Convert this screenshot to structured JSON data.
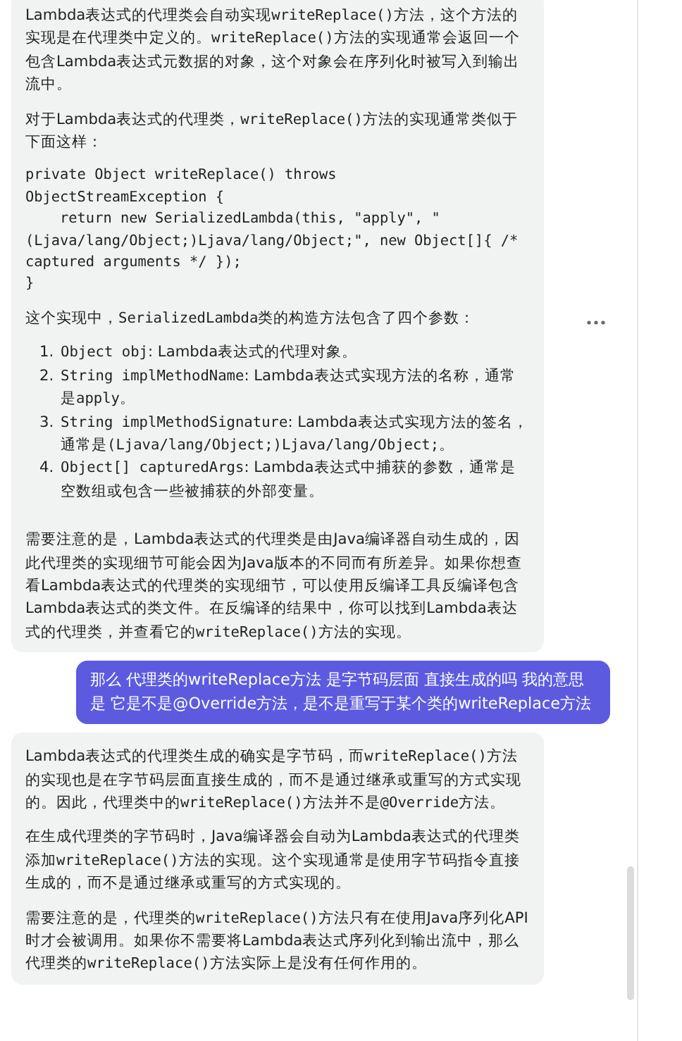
{
  "messages": [
    {
      "kind": "assistant_message",
      "blocks": [
        {
          "kind": "paragraph",
          "segments": [
            {
              "text": "Lambda表达式的代理类会自动实现",
              "code": false
            },
            {
              "text": "writeReplace()",
              "code": true
            },
            {
              "text": "方法，这个方法的实现是在代理类中定义的。",
              "code": false
            },
            {
              "text": "writeReplace()",
              "code": true
            },
            {
              "text": "方法的实现通常会返回一个包含Lambda表达式元数据的对象，这个对象会在序列化时被写入到输出流中。",
              "code": false
            }
          ]
        },
        {
          "kind": "paragraph",
          "segments": [
            {
              "text": "对于Lambda表达式的代理类，",
              "code": false
            },
            {
              "text": "writeReplace()",
              "code": true
            },
            {
              "text": "方法的实现通常类似于下面这样：",
              "code": false
            }
          ]
        },
        {
          "kind": "code_block",
          "lines": [
            "private Object writeReplace() throws",
            "ObjectStreamException {",
            "    return new SerializedLambda(this, \"apply\", \"",
            "(Ljava/lang/Object;)Ljava/lang/Object;\", new Object[]{ /*",
            "captured arguments */ });",
            "}"
          ]
        },
        {
          "kind": "paragraph",
          "segments": [
            {
              "text": "这个实现中，",
              "code": false
            },
            {
              "text": "SerializedLambda",
              "code": true
            },
            {
              "text": "类的构造方法包含了四个参数：",
              "code": false
            }
          ]
        },
        {
          "kind": "list",
          "items": [
            {
              "number": "1.",
              "segments": [
                {
                  "text": "Object obj",
                  "code": true
                },
                {
                  "text": ": Lambda表达式的代理对象。",
                  "code": false
                }
              ]
            },
            {
              "number": "2.",
              "segments": [
                {
                  "text": "String implMethodName",
                  "code": true
                },
                {
                  "text": ": Lambda表达式实现方法的名称，通常是",
                  "code": false
                },
                {
                  "text": "apply",
                  "code": true
                },
                {
                  "text": "。",
                  "code": false
                }
              ]
            },
            {
              "number": "3.",
              "segments": [
                {
                  "text": "String implMethodSignature",
                  "code": true
                },
                {
                  "text": ": Lambda表达式实现方法的签名，通常是",
                  "code": false
                },
                {
                  "text": "(Ljava/lang/Object;)Ljava/lang/Object;",
                  "code": true
                },
                {
                  "text": "。",
                  "code": false
                }
              ]
            },
            {
              "number": "4.",
              "segments": [
                {
                  "text": "Object[] capturedArgs",
                  "code": true
                },
                {
                  "text": ": Lambda表达式中捕获的参数，通常是空数组或包含一些被捕获的外部变量。",
                  "code": false
                }
              ]
            }
          ]
        },
        {
          "kind": "paragraph",
          "segments": [
            {
              "text": "需要注意的是，Lambda表达式的代理类是由Java编译器自动生成的，因此代理类的实现细节可能会因为Java版本的不同而有所差异。如果你想查看Lambda表达式的代理类的实现细节，可以使用反编译工具反编译包含Lambda表达式的类文件。在反编译的结果中，你可以找到Lambda表达式的代理类，并查看它的",
              "code": false
            },
            {
              "text": "writeReplace()",
              "code": true
            },
            {
              "text": "方法的实现。",
              "code": false
            }
          ]
        }
      ]
    },
    {
      "kind": "user_message",
      "text": "那么 代理类的writeReplace方法 是字节码层面 直接生成的吗 我的意思是 它是不是@Override方法，是不是重写于某个类的writeReplace方法"
    },
    {
      "kind": "assistant_message",
      "blocks": [
        {
          "kind": "paragraph",
          "segments": [
            {
              "text": "Lambda表达式的代理类生成的确实是字节码，而",
              "code": false
            },
            {
              "text": "writeReplace()",
              "code": true
            },
            {
              "text": "方法的实现也是在字节码层面直接生成的，而不是通过继承或重写的方式实现的。因此，代理类中的",
              "code": false
            },
            {
              "text": "writeReplace()",
              "code": true
            },
            {
              "text": "方法并不是",
              "code": false
            },
            {
              "text": "@Override",
              "code": true
            },
            {
              "text": "方法。",
              "code": false
            }
          ]
        },
        {
          "kind": "paragraph",
          "segments": [
            {
              "text": "在生成代理类的字节码时，Java编译器会自动为Lambda表达式的代理类添加",
              "code": false
            },
            {
              "text": "writeReplace()",
              "code": true
            },
            {
              "text": "方法的实现。这个实现通常是使用字节码指令直接生成的，而不是通过继承或重写的方式实现的。",
              "code": false
            }
          ]
        },
        {
          "kind": "paragraph",
          "segments": [
            {
              "text": "需要注意的是，代理类的",
              "code": false
            },
            {
              "text": "writeReplace()",
              "code": true
            },
            {
              "text": "方法只有在使用Java序列化API时才会被调用。如果你不需要将Lambda表达式序列化到输出流中，那么代理类的",
              "code": false
            },
            {
              "text": "writeReplace()",
              "code": true
            },
            {
              "text": "方法实际上是没有任何作用的。",
              "code": false
            }
          ]
        }
      ]
    }
  ]
}
